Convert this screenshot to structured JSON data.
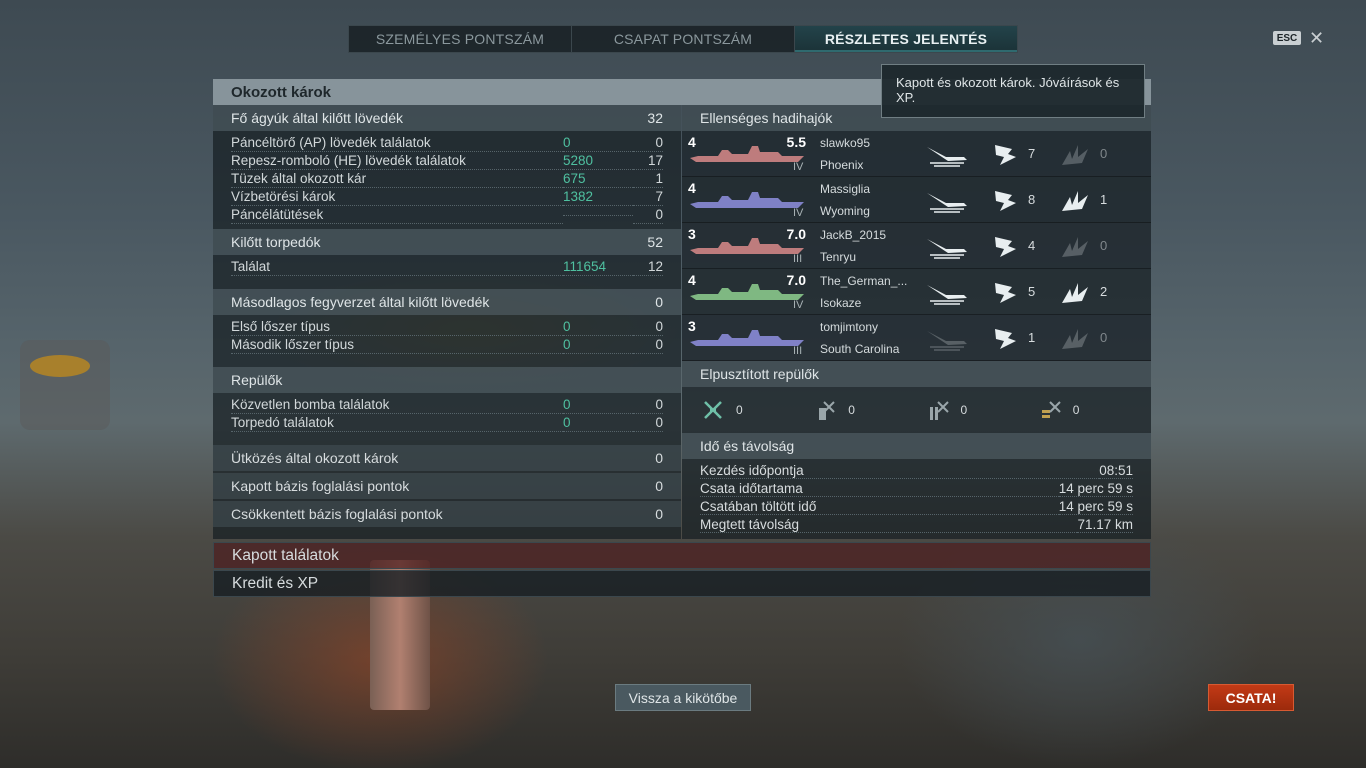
{
  "tabs": [
    "SZEMÉLYES PONTSZÁM",
    "CSAPAT PONTSZÁM",
    "RÉSZLETES JELENTÉS"
  ],
  "esc_label": "ESC",
  "tooltip": "Kapott és okozott károk. Jóváírások és XP.",
  "damage": {
    "title": "Okozott károk",
    "main_guns": {
      "label": "Fő ágyúk által kilőtt lövedék",
      "value": "32"
    },
    "main_rows": [
      {
        "label": "Páncéltörő (AP) lövedék találatok",
        "dmg": "0",
        "count": "0"
      },
      {
        "label": "Repesz-romboló (HE) lövedék találatok",
        "dmg": "5280",
        "count": "17"
      },
      {
        "label": "Tüzek által okozott kár",
        "dmg": "675",
        "count": "1"
      },
      {
        "label": "Vízbetörési károk",
        "dmg": "1382",
        "count": "7"
      },
      {
        "label": "Páncélátütések",
        "dmg": "",
        "count": "0"
      }
    ],
    "torpedoes": {
      "label": "Kilőtt torpedók",
      "value": "52"
    },
    "torp_rows": [
      {
        "label": "Találat",
        "dmg": "111654",
        "count": "12"
      }
    ],
    "secondary": {
      "label": "Másodlagos fegyverzet által kilőtt lövedék",
      "value": "0"
    },
    "sec_rows": [
      {
        "label": "Első lőszer típus",
        "dmg": "0",
        "count": "0"
      },
      {
        "label": "Második lőszer típus",
        "dmg": "0",
        "count": "0"
      }
    ],
    "aircraft": {
      "label": "Repülők"
    },
    "air_rows": [
      {
        "label": "Közvetlen bomba találatok",
        "dmg": "0",
        "count": "0"
      },
      {
        "label": "Torpedó találatok",
        "dmg": "0",
        "count": "0"
      }
    ],
    "ramming": {
      "label": "Ütközés által okozott károk",
      "value": "0"
    },
    "base_cap": {
      "label": "Kapott bázis foglalási pontok",
      "value": "0"
    },
    "base_def": {
      "label": "Csökkentett bázis foglalási pontok",
      "value": "0"
    }
  },
  "enemy": {
    "title": "Ellenséges hadihajók",
    "ships": [
      {
        "tier": "4",
        "exp": "5.5",
        "player": "slawko95",
        "ship": "Phoenix",
        "roman": "IV",
        "color": "#d98a8a",
        "a": "",
        "b": "7",
        "c": "0",
        "a_dim": false,
        "c_dim": true
      },
      {
        "tier": "4",
        "exp": "",
        "player": "Massiglia",
        "ship": "Wyoming",
        "roman": "IV",
        "color": "#8f8fe0",
        "a": "",
        "b": "8",
        "c": "1",
        "a_dim": false,
        "c_dim": false
      },
      {
        "tier": "3",
        "exp": "7.0",
        "player": "JackB_2015",
        "ship": "Tenryu",
        "roman": "III",
        "color": "#d98a8a",
        "a": "",
        "b": "4",
        "c": "0",
        "a_dim": false,
        "c_dim": true
      },
      {
        "tier": "4",
        "exp": "7.0",
        "player": "The_German_...",
        "ship": "Isokaze",
        "roman": "IV",
        "color": "#8fd08f",
        "a": "",
        "b": "5",
        "c": "2",
        "a_dim": false,
        "c_dim": false
      },
      {
        "tier": "3",
        "exp": "",
        "player": "tomjimtony",
        "ship": "South Carolina",
        "roman": "III",
        "color": "#8f8fe0",
        "a": "",
        "b": "1",
        "c": "0",
        "a_dim": true,
        "c_dim": true
      }
    ]
  },
  "planes": {
    "title": "Elpusztított repülők",
    "values": [
      "0",
      "0",
      "0",
      "0"
    ]
  },
  "time": {
    "title": "Idő és távolság",
    "rows": [
      {
        "label": "Kezdés időpontja",
        "value": "08:51"
      },
      {
        "label": "Csata időtartama",
        "value": "14 perc 59 s"
      },
      {
        "label": "Csatában töltött idő",
        "value": "14 perc 59 s"
      },
      {
        "label": "Megtett távolság",
        "value": "71.17 km"
      }
    ]
  },
  "received": "Kapott találatok",
  "credits": "Kredit és XP",
  "back_button": "Vissza a kikötőbe",
  "battle_button": "CSATA!"
}
